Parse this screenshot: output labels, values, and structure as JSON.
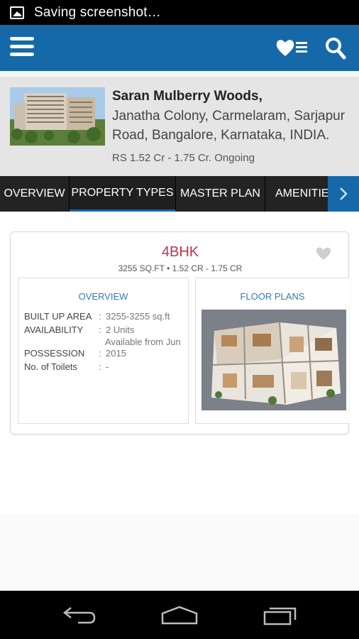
{
  "status_bar": {
    "text": "Saving screenshot…",
    "icon": "image-icon"
  },
  "app_bar": {
    "menu_icon": "hamburger-menu-icon",
    "favorites_icon": "heart-list-icon",
    "search_icon": "search-icon",
    "color": "#1669a8"
  },
  "project": {
    "name": "Saran Mulberry Woods,",
    "address": "Janatha Colony, Carmelaram, Sarjapur Road, Bangalore, Karnataka, INDIA.",
    "price_status": "RS 1.52 Cr - 1.75 Cr. Ongoing"
  },
  "tabs": [
    {
      "label": "OVERVIEW",
      "active": false
    },
    {
      "label": "PROPERTY TYPES",
      "active": true
    },
    {
      "label": "MASTER PLAN",
      "active": false
    },
    {
      "label": "AMENITIES",
      "active": false
    }
  ],
  "unit": {
    "title": "4BHK",
    "subtitle": "3255 SQ.FT • 1.52 CR - 1.75 CR",
    "overview_title": "OVERVIEW",
    "floor_plans_title": "FLOOR PLANS",
    "specs": {
      "built_up_label": "BUILT UP AREA",
      "built_up_value": "3255-3255 sq.ft",
      "availability_label": "AVAILABILITY",
      "availability_value": "2 Units",
      "availability_value2": "Available from Jun",
      "possession_label": "POSSESSION",
      "possession_value": "2015",
      "toilets_label": "No. of Toilets",
      "toilets_value": "-"
    },
    "colon": ":"
  },
  "colors": {
    "accent": "#1669a8",
    "title": "#c0304f",
    "link": "#2f7bb5"
  }
}
